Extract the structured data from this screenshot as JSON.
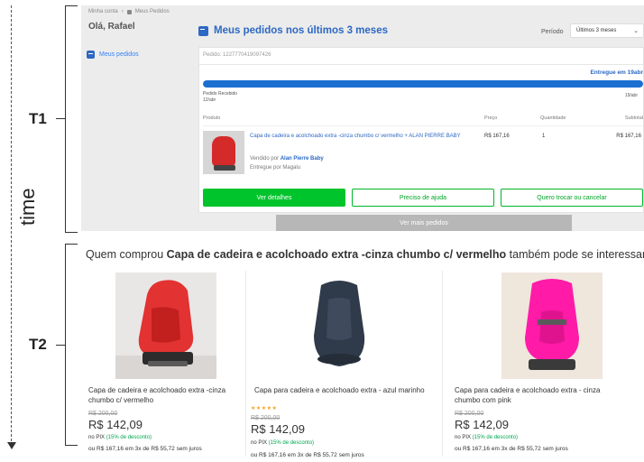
{
  "annotations": {
    "time_label": "time",
    "t1_label": "T1",
    "t2_label": "T2"
  },
  "t1": {
    "breadcrumb": [
      "Minha conta",
      "Meus Pedidos"
    ],
    "greeting": "Olá, Rafael",
    "sidebar_item": "Meus pedidos",
    "panel_title": "Meus pedidos nos últimos 3 meses",
    "period_label": "Período",
    "period_value": "Últimos 3 meses",
    "order_id": "Pedido: 1227770419097426",
    "delivered": "Entregue em 19abr",
    "progress_fraction": 1.0,
    "step_left_label": "Pedido Recebido",
    "step_left_date": "12/abr",
    "step_right_date": "19/abr",
    "columns": [
      "Produto",
      "Preço",
      "Quantidade",
      "Subtotal"
    ],
    "product_name": "Capa de cadeira e acolchoado extra -cinza chumbo c/ vermelho + ALAN PIERRE BABY",
    "sold_by_prefix": "Vendido por",
    "sold_by": "Alan Pierre Baby",
    "delivered_by": "Entregue por Magalu",
    "price": "R$ 167,16",
    "quantity": "1",
    "subtotal": "R$ 167,16",
    "btn_details": "Ver detalhes",
    "btn_help": "Preciso de ajuda",
    "btn_exchange": "Quero trocar ou cancelar",
    "btn_more": "Ver mais pedidos"
  },
  "t2": {
    "title_prefix": "Quem comprou",
    "title_product": "Capa de cadeira e acolchoado extra -cinza chumbo c/ vermelho",
    "title_suffix": "também pode se interessar",
    "products": [
      {
        "name": "Capa de cadeira e acolchoado extra -cinza chumbo c/ vermelho",
        "old_price": "R$ 200,00",
        "price": "R$ 142,09",
        "pix": "no PIX",
        "discount": "(15% de desconto)",
        "installments": "ou R$ 167,16 em 3x de R$ 55,72 sem juros",
        "seat_color": "#e23232"
      },
      {
        "name": "Capa para cadeira e acolchoado extra - azul marinho",
        "stars": "★★★★★",
        "old_price": "R$ 200,00",
        "price": "R$ 142,09",
        "pix": "no PIX",
        "discount": "(15% de desconto)",
        "installments": "ou R$ 167,16 em 3x de R$ 55,72 sem juros",
        "seat_color": "#2f3a4a"
      },
      {
        "name": "Capa para cadeira e acolchoado extra - cinza chumbo com pink",
        "old_price": "R$ 200,00",
        "price": "R$ 142,09",
        "pix": "no PIX",
        "discount": "(15% de desconto)",
        "installments": "ou R$ 167,16 em 3x de R$ 55,72 sem juros",
        "seat_color": "#ff1aa8"
      }
    ]
  },
  "colors": {
    "accent_blue": "#2d68c4",
    "green": "#00c42b",
    "discount_green": "#00a650"
  }
}
